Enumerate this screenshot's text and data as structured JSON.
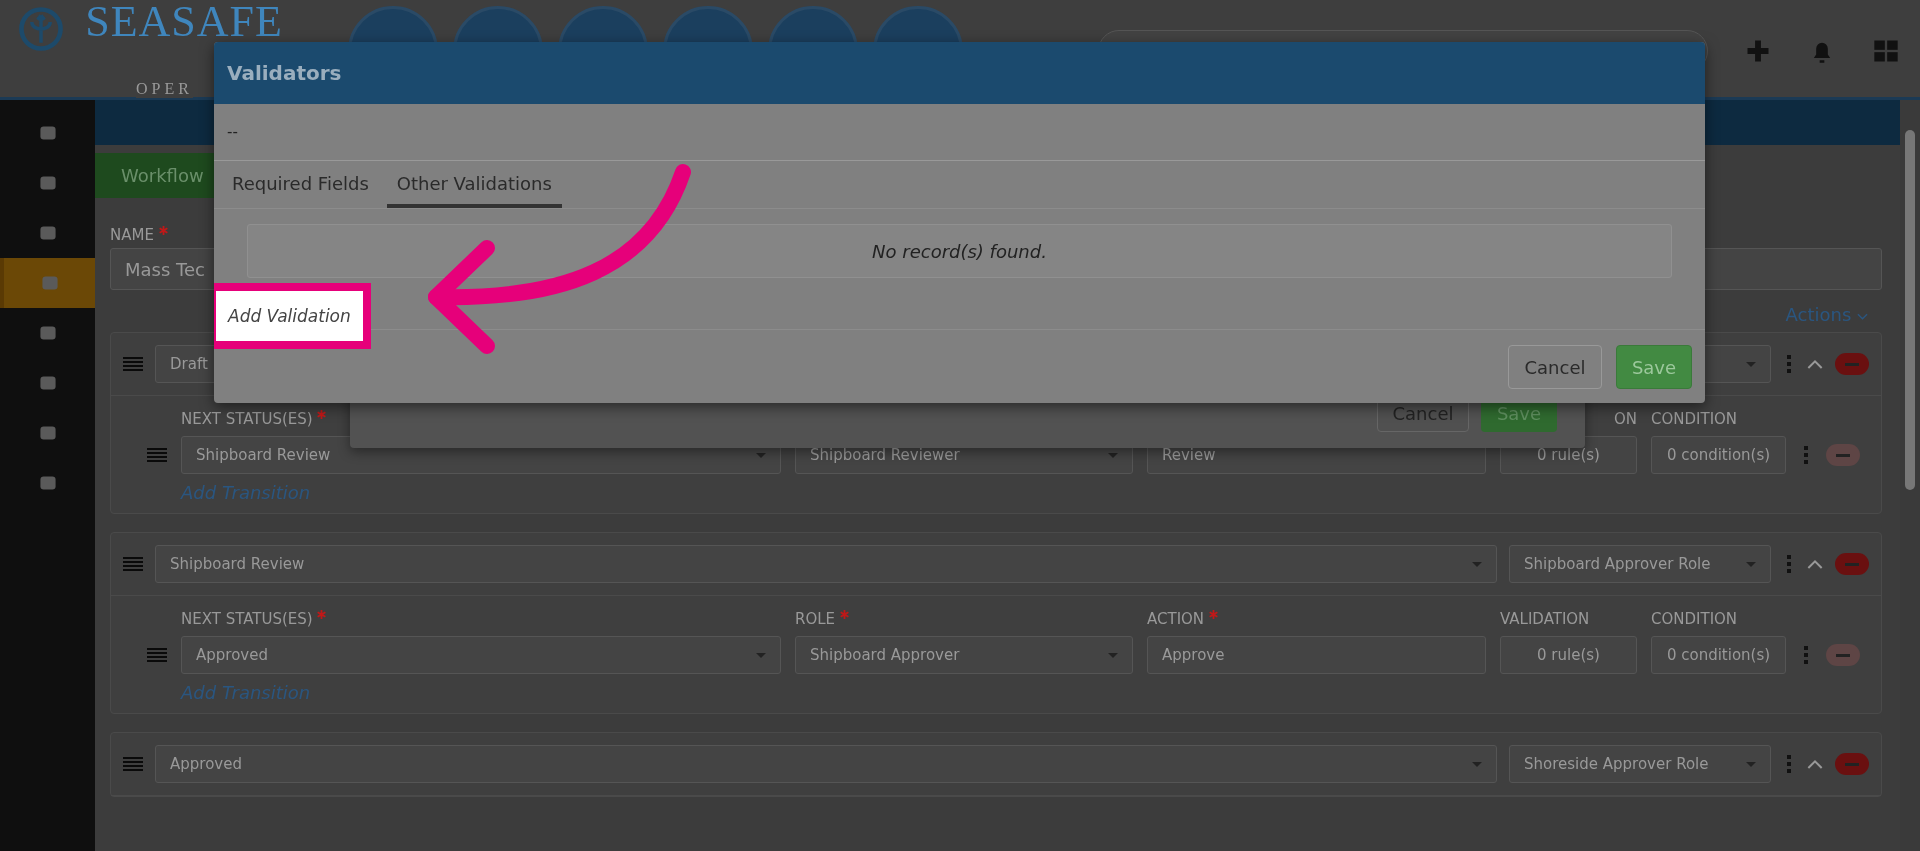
{
  "header": {
    "logo_text": "SEASAFE",
    "logo_subtext": "OPER"
  },
  "sidebar": {
    "items": [
      {
        "selected": false
      },
      {
        "selected": false
      },
      {
        "selected": false
      },
      {
        "selected": true
      },
      {
        "selected": false
      },
      {
        "selected": false
      },
      {
        "selected": false
      },
      {
        "selected": false
      }
    ]
  },
  "page": {
    "tab": "Workflow",
    "name_label": "NAME",
    "name_value": "Mass Tec",
    "actions": "Actions"
  },
  "statuses": [
    {
      "status": "Draft",
      "transitions": [
        {
          "labels": {
            "next": "NEXT STATUS(ES)",
            "validation": "ON",
            "condition": "CONDITION"
          },
          "next": "Shipboard Review",
          "role": "Shipboard Reviewer",
          "action": "Review",
          "validation": "0 rule(s)",
          "condition": "0 condition(s)"
        }
      ],
      "add_transition": "Add Transition"
    },
    {
      "status": "Shipboard Review",
      "role": "Shipboard Approver Role",
      "transitions": [
        {
          "labels": {
            "next": "NEXT STATUS(ES)",
            "role": "ROLE",
            "action": "ACTION",
            "validation": "VALIDATION",
            "condition": "CONDITION"
          },
          "next": "Approved",
          "role": "Shipboard Approver",
          "action": "Approve",
          "validation": "0 rule(s)",
          "condition": "0 condition(s)"
        }
      ],
      "add_transition": "Add Transition"
    },
    {
      "status": "Approved",
      "role": "Shoreside Approver Role"
    }
  ],
  "back_modal": {
    "buttons": [
      "Cancel",
      "Save"
    ]
  },
  "modal": {
    "title": "Validators",
    "subtitle": "--",
    "tabs": [
      {
        "label": "Required Fields",
        "selected": false
      },
      {
        "label": "Other Validations",
        "selected": true
      }
    ],
    "empty_text": "No record(s) found.",
    "add_link": "Add Validation",
    "buttons": [
      "Cancel",
      "Save"
    ]
  }
}
